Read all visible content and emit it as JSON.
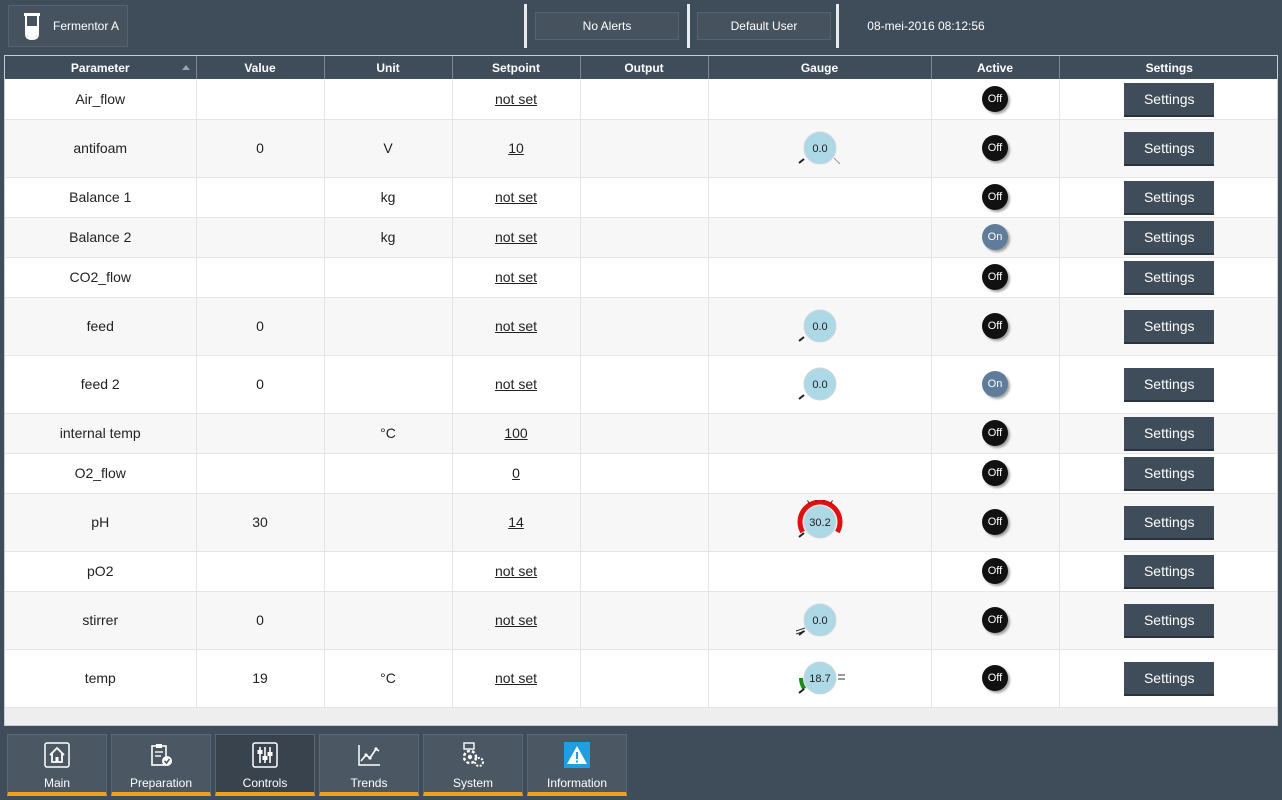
{
  "header": {
    "device_name": "Fermentor A",
    "alerts": "No Alerts",
    "user": "Default User",
    "datetime": "08-mei-2016 08:12:56"
  },
  "table": {
    "columns": [
      "Parameter",
      "Value",
      "Unit",
      "Setpoint",
      "Output",
      "Gauge",
      "Active",
      "Settings"
    ],
    "settings_label": "Settings",
    "rows": [
      {
        "parameter": "Air_flow",
        "value": "",
        "unit": "",
        "setpoint": "not set",
        "output": "",
        "gauge": null,
        "active": "Off"
      },
      {
        "parameter": "antifoam",
        "value": "0",
        "unit": "V",
        "setpoint": "10",
        "output": "",
        "gauge": {
          "reading": "0.0",
          "style": "low"
        },
        "active": "Off"
      },
      {
        "parameter": "Balance 1",
        "value": "",
        "unit": "kg",
        "setpoint": "not set",
        "output": "",
        "gauge": null,
        "active": "Off"
      },
      {
        "parameter": "Balance 2",
        "value": "",
        "unit": "kg",
        "setpoint": "not set",
        "output": "",
        "gauge": null,
        "active": "On"
      },
      {
        "parameter": "CO2_flow",
        "value": "",
        "unit": "",
        "setpoint": "not set",
        "output": "",
        "gauge": null,
        "active": "Off"
      },
      {
        "parameter": "feed",
        "value": "0",
        "unit": "",
        "setpoint": "not set",
        "output": "",
        "gauge": {
          "reading": "0.0",
          "style": "plain"
        },
        "active": "Off"
      },
      {
        "parameter": "feed 2",
        "value": "0",
        "unit": "",
        "setpoint": "not set",
        "output": "",
        "gauge": {
          "reading": "0.0",
          "style": "plain"
        },
        "active": "On"
      },
      {
        "parameter": "internal temp",
        "value": "",
        "unit": "°C",
        "setpoint": "100",
        "output": "",
        "gauge": null,
        "active": "Off"
      },
      {
        "parameter": "O2_flow",
        "value": "",
        "unit": "",
        "setpoint": "0",
        "output": "",
        "gauge": null,
        "active": "Off"
      },
      {
        "parameter": "pH",
        "value": "30",
        "unit": "",
        "setpoint": "14",
        "output": "",
        "gauge": {
          "reading": "30.2",
          "style": "alarm"
        },
        "active": "Off"
      },
      {
        "parameter": "pO2",
        "value": "",
        "unit": "",
        "setpoint": "not set",
        "output": "",
        "gauge": null,
        "active": "Off"
      },
      {
        "parameter": "stirrer",
        "value": "0",
        "unit": "",
        "setpoint": "not set",
        "output": "",
        "gauge": {
          "reading": "0.0",
          "style": "ticks"
        },
        "active": "Off"
      },
      {
        "parameter": "temp",
        "value": "19",
        "unit": "°C",
        "setpoint": "not set",
        "output": "",
        "gauge": {
          "reading": "18.7",
          "style": "green"
        },
        "active": "Off"
      }
    ]
  },
  "nav": {
    "items": [
      {
        "label": "Main",
        "icon": "home-icon"
      },
      {
        "label": "Preparation",
        "icon": "clipboard-check-icon"
      },
      {
        "label": "Controls",
        "icon": "sliders-icon"
      },
      {
        "label": "Trends",
        "icon": "chart-line-icon"
      },
      {
        "label": "System",
        "icon": "gears-icon"
      },
      {
        "label": "Information",
        "icon": "warning-icon"
      }
    ],
    "active": "Controls"
  },
  "colors": {
    "bar_bg": "#3f4c59",
    "nav_accent": "#f0a020",
    "toggle_off": "#111111",
    "toggle_on": "#5f7d9a",
    "gauge_face": "#add8e6",
    "gauge_alarm": "#e01010",
    "gauge_ok": "#1a8a1a",
    "info_icon": "#1ea0e0"
  }
}
